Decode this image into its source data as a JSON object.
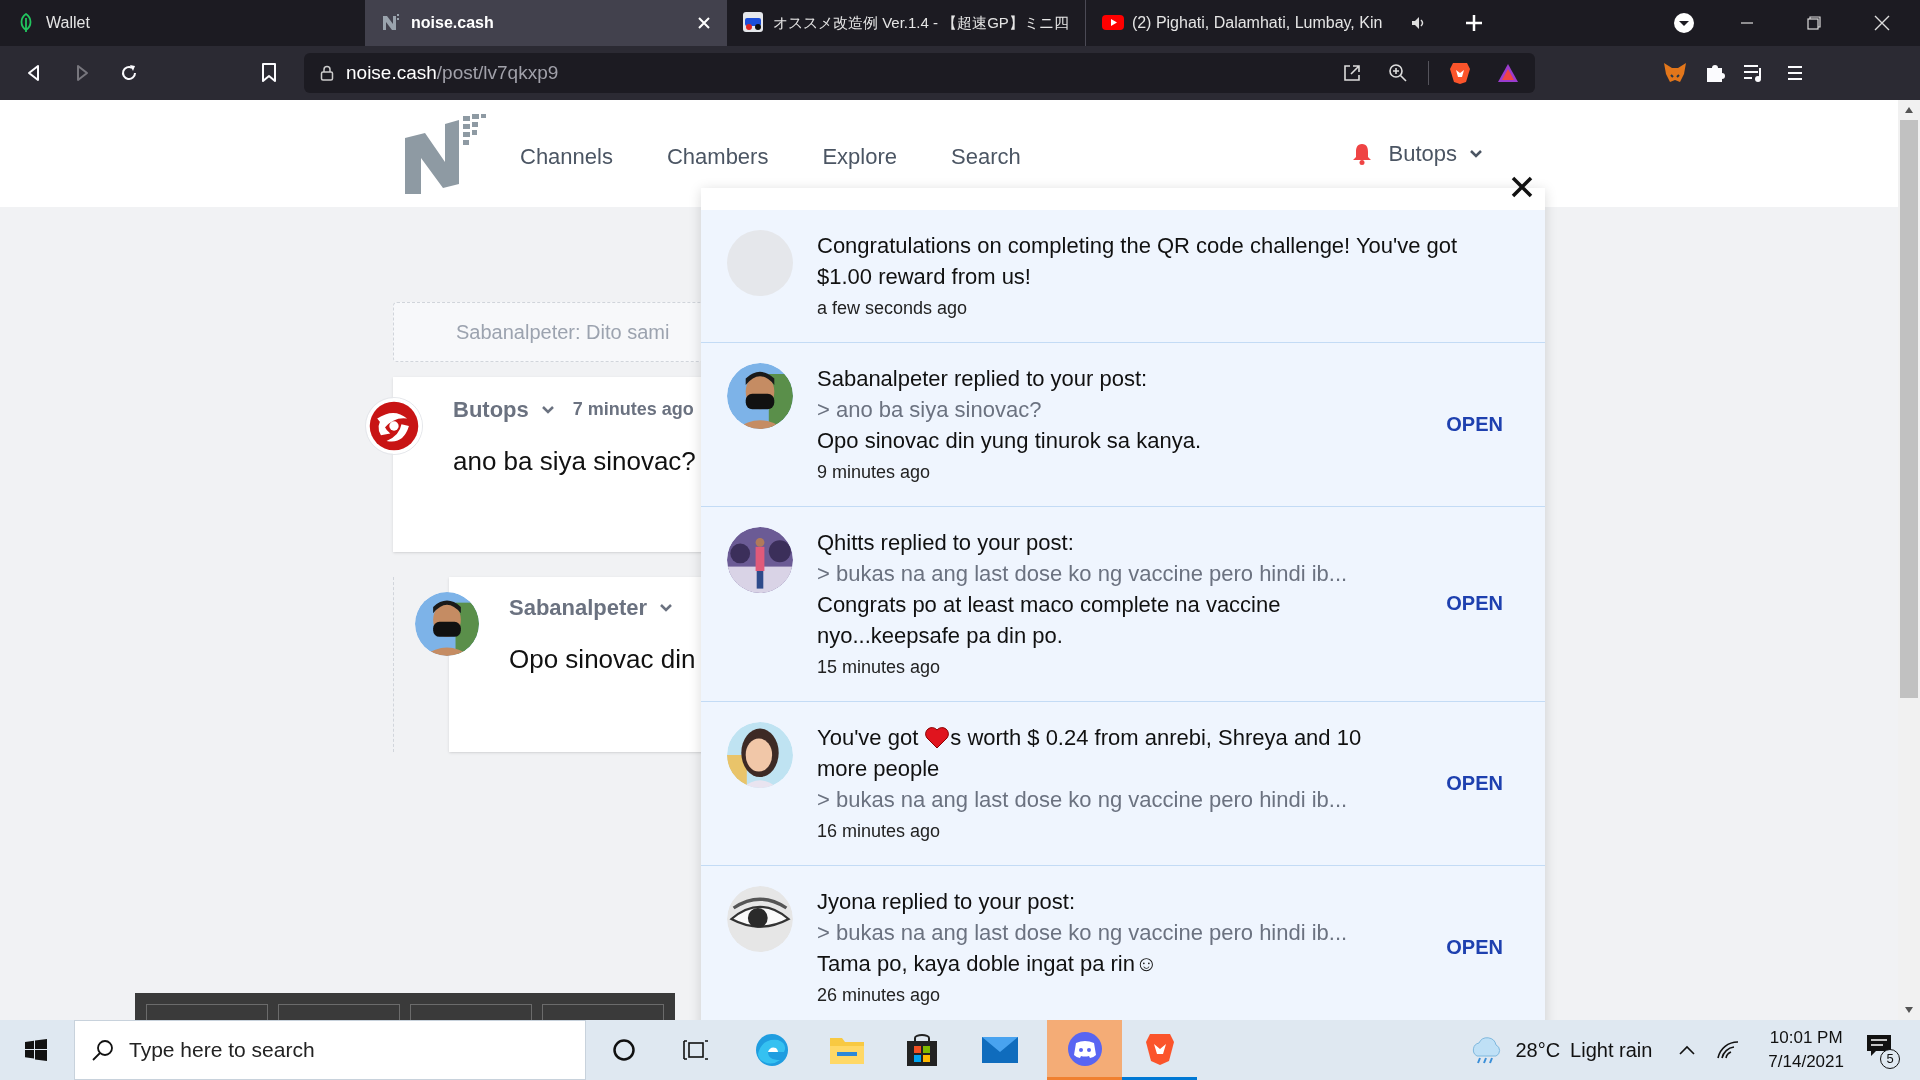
{
  "browser": {
    "tabs": [
      {
        "title": "Wallet",
        "selected": false,
        "audio": false
      },
      {
        "title": "noise.cash",
        "selected": true,
        "audio": false
      },
      {
        "title": "オススメ改造例 Ver.1.4 - 【超速GP】ミニ四",
        "selected": false,
        "audio": false
      },
      {
        "title": "(2) Pighati, Dalamhati, Lumbay, Kin",
        "selected": false,
        "audio": true
      }
    ],
    "address": {
      "host": "noise.cash",
      "path": "/post/lv7qkxp9"
    }
  },
  "site": {
    "nav": [
      "Channels",
      "Chambers",
      "Explore",
      "Search"
    ],
    "user": "Butops"
  },
  "quote": "Sabanalpeter: Dito sami",
  "posts": [
    {
      "author": "Butops",
      "time": "7 minutes ago",
      "body": "ano ba siya sinovac?"
    },
    {
      "author": "Sabanalpeter",
      "body": "Opo sinovac din"
    }
  ],
  "notifications": [
    {
      "kind": "reward",
      "title": "Congratulations on completing the QR code challenge! You've got $1.00 reward from us!",
      "time": "a few seconds ago"
    },
    {
      "kind": "reply",
      "title": "Sabanalpeter replied to your post:",
      "quote": "> ano ba siya sinovac?",
      "body": "Opo sinovac din yung tinurok sa kanya.",
      "time": "9 minutes ago",
      "action": "OPEN"
    },
    {
      "kind": "reply",
      "title": "Qhitts replied to your post:",
      "quote": "> bukas na ang last dose ko ng vaccine pero hindi ib...",
      "body": "Congrats po at least maco complete na vaccine nyo...keepsafe pa din po.",
      "time": "15 minutes ago",
      "action": "OPEN"
    },
    {
      "kind": "hearts",
      "title": "You've got",
      "title_after": "s worth $ 0.24 from anrebi, Shreya and 10",
      "title_line2": "more people",
      "quote": "> bukas na ang last dose ko ng vaccine pero hindi ib...",
      "time": "16 minutes ago",
      "action": "OPEN"
    },
    {
      "kind": "reply",
      "title": "Jyona replied to your post:",
      "quote": "> bukas na ang last dose ko ng vaccine pero hindi ib...",
      "body": "Tama po, kaya doble ingat pa rin☺",
      "time": "26 minutes ago",
      "action": "OPEN"
    }
  ],
  "taskbar": {
    "search_placeholder": "Type here to search",
    "temperature": "28°C",
    "weather": "Light rain",
    "time": "10:01 PM",
    "date": "7/14/2021",
    "notification_count": "5"
  }
}
